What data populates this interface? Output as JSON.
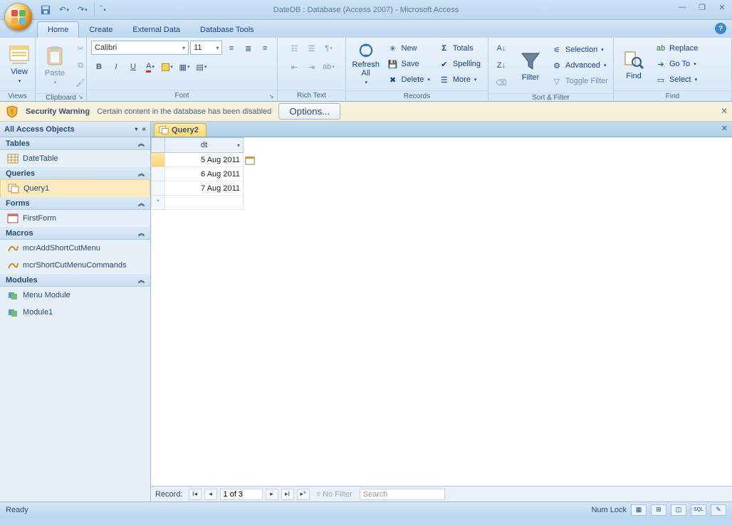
{
  "window": {
    "title": "DateDB : Database (Access 2007) - Microsoft Access"
  },
  "tabs": {
    "home": "Home",
    "create": "Create",
    "external": "External Data",
    "dbtools": "Database Tools"
  },
  "ribbon": {
    "views": {
      "view": "View",
      "label": "Views"
    },
    "clipboard": {
      "paste": "Paste",
      "label": "Clipboard"
    },
    "font": {
      "name": "Calibri",
      "size": "11",
      "label": "Font"
    },
    "richtext": {
      "label": "Rich Text"
    },
    "records": {
      "refresh": "Refresh\nAll",
      "new": "New",
      "save": "Save",
      "delete": "Delete",
      "totals": "Totals",
      "spelling": "Spelling",
      "more": "More",
      "label": "Records"
    },
    "sortfilter": {
      "filter": "Filter",
      "selection": "Selection",
      "advanced": "Advanced",
      "toggle": "Toggle Filter",
      "label": "Sort & Filter"
    },
    "find": {
      "find": "Find",
      "replace": "Replace",
      "goto": "Go To",
      "select": "Select",
      "label": "Find"
    }
  },
  "security": {
    "title": "Security Warning",
    "message": "Certain content in the database has been disabled",
    "options": "Options..."
  },
  "navpane": {
    "header": "All Access Objects",
    "groups": {
      "tables": "Tables",
      "queries": "Queries",
      "forms": "Forms",
      "macros": "Macros",
      "modules": "Modules"
    },
    "items": {
      "datetable": "DateTable",
      "query1": "Query1",
      "firstform": "FirstForm",
      "macro1": "mcrAddShortCutMenu",
      "macro2": "mcrShortCutMenuCommands",
      "mod1": "Menu Module",
      "mod2": "Module1"
    }
  },
  "doc": {
    "tab": "Query2",
    "column": "dt",
    "rows": [
      "5 Aug 2011",
      "6 Aug 2011",
      "7 Aug 2011"
    ]
  },
  "recnav": {
    "label": "Record:",
    "pos": "1 of 3",
    "nofilter": "No Filter",
    "search": "Search"
  },
  "status": {
    "ready": "Ready",
    "numlock": "Num Lock"
  }
}
